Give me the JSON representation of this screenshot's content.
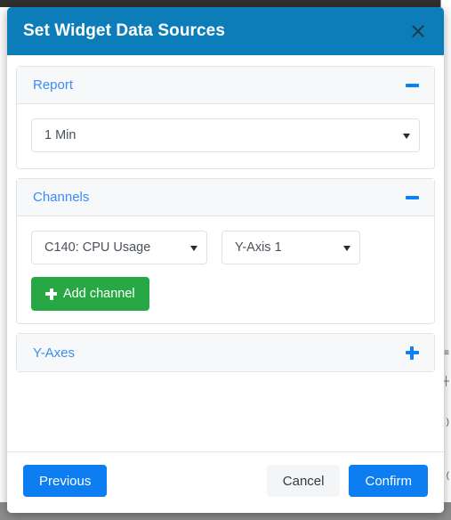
{
  "modal": {
    "title": "Set Widget Data Sources",
    "close_icon": "close-icon",
    "header_color": "#0d7dba"
  },
  "panels": [
    {
      "key": "report",
      "title": "Report",
      "collapsed": false,
      "toggle_icon": "minus-icon",
      "select": {
        "value": "1 Min",
        "caret_icon": "caret-down-icon"
      }
    },
    {
      "key": "channels",
      "title": "Channels",
      "collapsed": false,
      "toggle_icon": "minus-icon",
      "channel_select": {
        "value": "C140: CPU Usage",
        "caret_icon": "caret-down-icon"
      },
      "yaxis_select": {
        "value": "Y-Axis 1",
        "caret_icon": "caret-down-icon"
      },
      "add_button": {
        "label": "Add channel",
        "icon": "plus-icon",
        "color": "#28a745"
      }
    },
    {
      "key": "y-axes",
      "title": "Y-Axes",
      "collapsed": true,
      "toggle_icon": "plus-icon"
    }
  ],
  "footer": {
    "previous_label": "Previous",
    "cancel_label": "Cancel",
    "confirm_label": "Confirm",
    "primary_color": "#0d7ef2"
  }
}
